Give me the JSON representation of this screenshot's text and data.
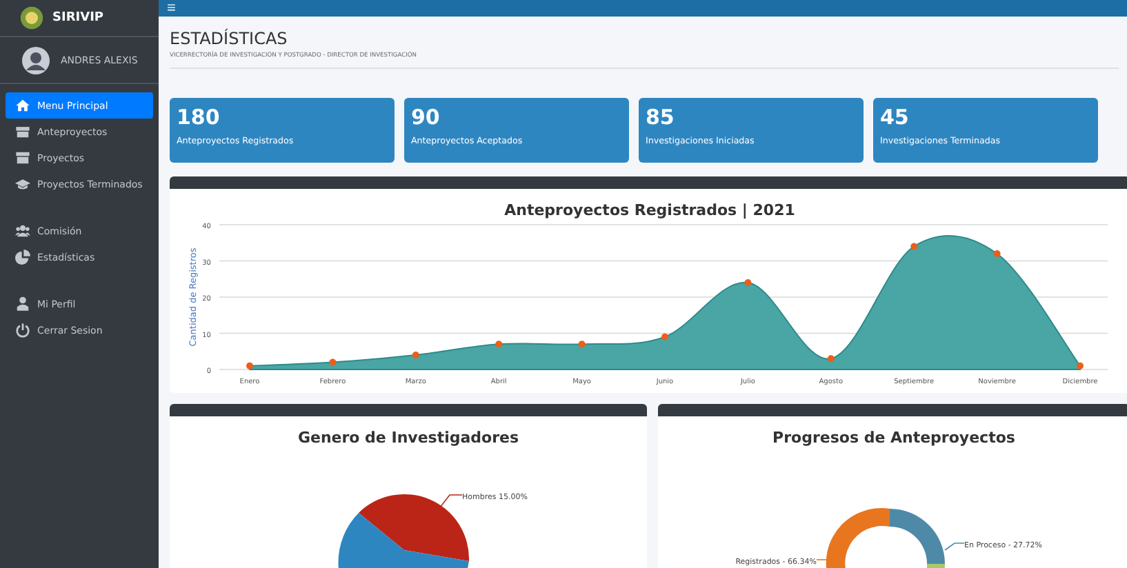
{
  "sidebar": {
    "brand": "SIRIVIP",
    "user": "ANDRES ALEXIS",
    "sections": [
      {
        "items": [
          {
            "label": "Menu Principal",
            "selected": true
          },
          {
            "label": "Anteproyectos",
            "selected": false
          },
          {
            "label": "Proyectos",
            "selected": false
          },
          {
            "label": "Proyectos Terminados",
            "selected": false
          }
        ]
      },
      {
        "items": [
          {
            "label": "Comisión",
            "selected": false
          },
          {
            "label": "Estadísticas",
            "selected": false
          }
        ]
      },
      {
        "items": [
          {
            "label": "Mi Perfil",
            "selected": false
          },
          {
            "label": "Cerrar Sesion",
            "selected": false
          }
        ]
      }
    ]
  },
  "topbar": {
    "menu_icon": "≡"
  },
  "header": {
    "title": "ESTADÍSTICAS",
    "subtitle": "VICERRECTORÍA DE INVESTIGACIÓN Y POSTGRADO - DIRECTOR DE INVESTIGACIÓN"
  },
  "stats": [
    {
      "value": "180",
      "label": "Anteproyectos Registrados"
    },
    {
      "value": "90",
      "label": "Anteproyectos Aceptados"
    },
    {
      "value": "85",
      "label": "Investigaciones Iniciadas"
    },
    {
      "value": "45",
      "label": "Investigaciones Terminadas"
    }
  ],
  "registros_chart": {
    "chart_data": {
      "type": "area",
      "title": "Anteproyectos Registrados | 2021",
      "ylabel": "Cantidad de Registros",
      "categories": [
        "Enero",
        "Febrero",
        "Marzo",
        "Abril",
        "Mayo",
        "Junio",
        "Julio",
        "Agosto",
        "Septiembre",
        "Noviembre",
        "Diciembre"
      ],
      "series": [
        {
          "color": "#4aa5a5",
          "values": [
            1,
            2,
            4,
            7,
            7,
            9,
            24,
            3,
            34,
            32,
            1
          ]
        }
      ],
      "ylim": [
        0,
        40
      ],
      "yticks": [
        0,
        10,
        20,
        30,
        40
      ],
      "grid": true
    }
  },
  "genero_chart": {
    "title": "Genero de Investigadores",
    "labels": [
      "Hombres 15.00%"
    ]
  },
  "progreso_chart": {
    "title": "Progresos de Anteproyectos",
    "labels": [
      "En Proceso - 27.72%",
      "Registrados - 66.34%"
    ]
  }
}
